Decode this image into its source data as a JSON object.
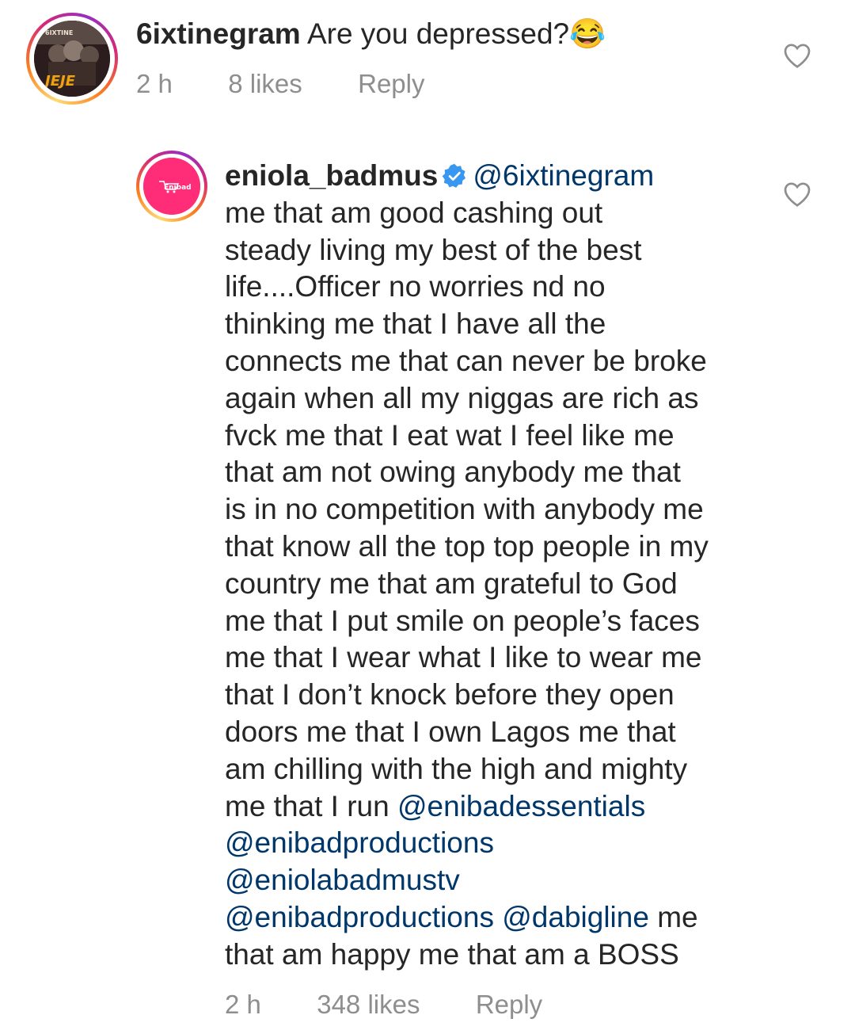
{
  "comments": [
    {
      "username": "6ixtinegram",
      "text": " Are you depressed?😂",
      "time": "2 h",
      "likes": "8 likes",
      "reply": "Reply",
      "avatar_text": "JEJE"
    },
    {
      "username": "eniola_badmus",
      "verified": true,
      "mention_1": "@6ixtinegram",
      "body_1": "me that am good cashing out\nsteady living my best of the best\nlife....Officer no worries nd no\nthinking me that I have all the\nconnects me that can never be broke\nagain when all my niggas are rich as\nfvck me that I eat wat I feel like me\nthat am not owing anybody me that\nis in no competition with anybody me\nthat know all the top top people in my\ncountry me that am grateful to God\nme that I put smile on people’s faces\nme that I wear what I like to wear me\nthat I don’t knock before they open\ndoors me that I own Lagos me that\nam chilling with the high and mighty\nme that I run ",
      "mention_2": "@enibadessentials",
      "mention_3": "@enibadproductions",
      "mention_4": "@eniolabadmustv",
      "mention_5": "@enibadproductions",
      "mention_6": "@dabigline",
      "body_2": " me\nthat am happy me that am a BOSS",
      "time": "2 h",
      "likes": "348 likes",
      "reply": "Reply",
      "avatar_text": "Enibad"
    }
  ],
  "colors": {
    "text": "#262626",
    "meta": "#8e8e8e",
    "mention": "#00376b",
    "verified": "#3897f0",
    "enibad_pink": "#ff2d78"
  },
  "icons": [
    "heart-icon",
    "verified-badge-icon"
  ]
}
